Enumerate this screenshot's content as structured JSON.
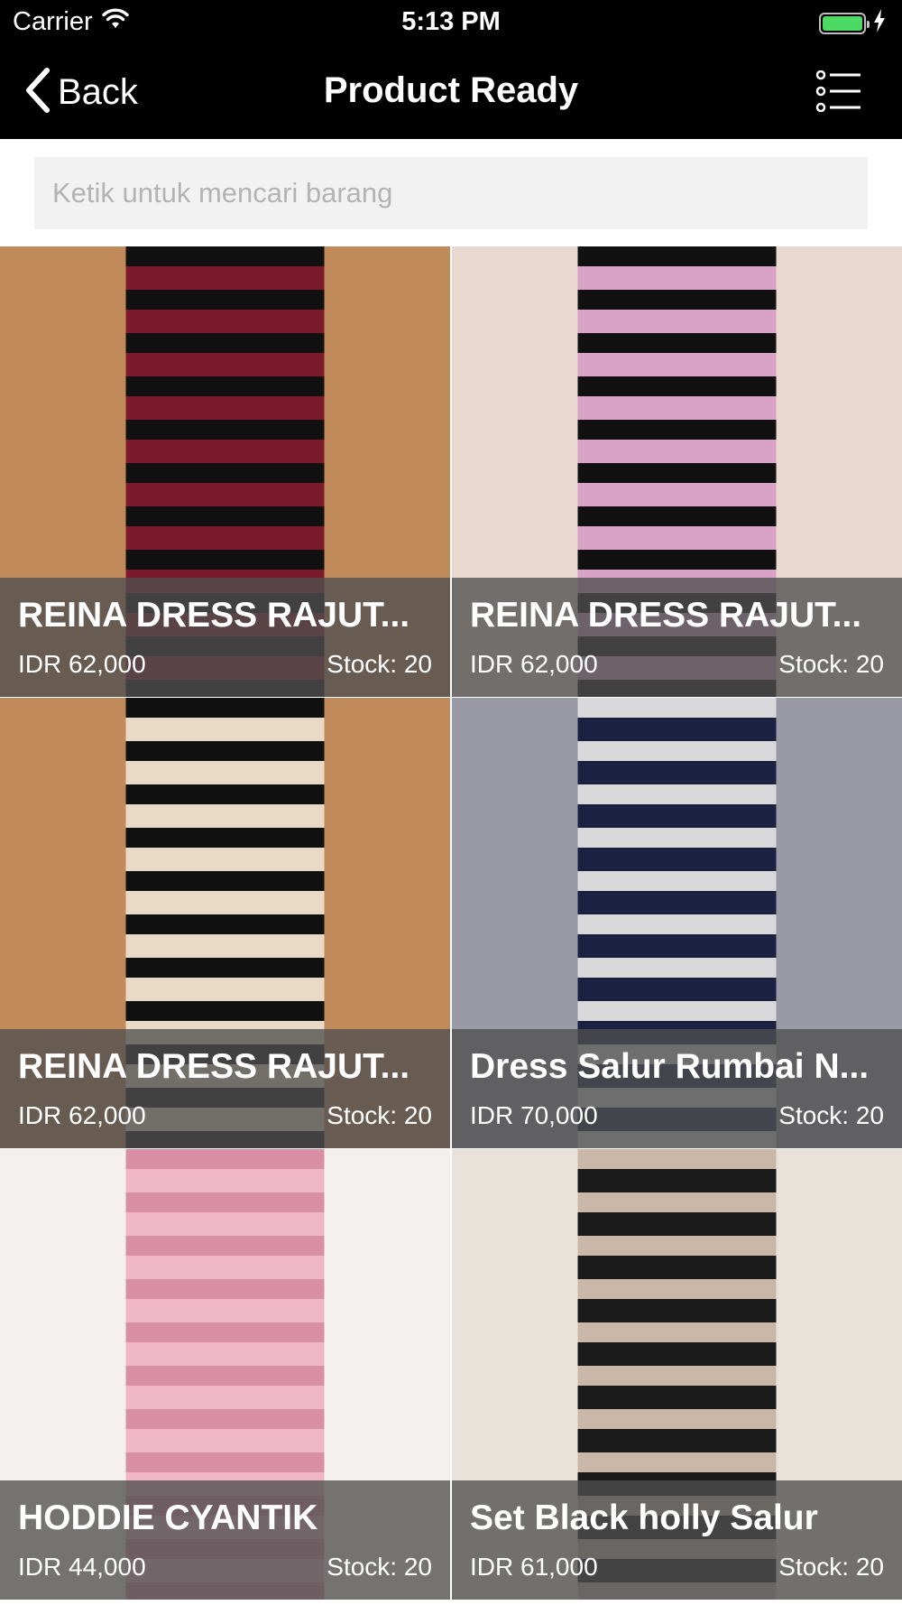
{
  "status_bar": {
    "carrier": "Carrier",
    "time": "5:13 PM",
    "icons": [
      "wifi-icon",
      "battery-icon",
      "charging-bolt-icon"
    ],
    "battery_color": "#4cd964"
  },
  "nav": {
    "back_label": "Back",
    "title": "Product Ready",
    "menu_icon": "list-menu-icon",
    "background": "#000000"
  },
  "search": {
    "placeholder": "Ketik untuk mencari barang",
    "value": ""
  },
  "products": [
    {
      "name": "REINA DRESS RAJUT...",
      "price": "IDR 62,000",
      "stock": "Stock: 20",
      "image": "model in black and maroon striped knit dress",
      "palette": [
        "#c08a5a",
        "#7a1a2a",
        "#111111"
      ]
    },
    {
      "name": "REINA DRESS RAJUT...",
      "price": "IDR 62,000",
      "stock": "Stock: 20",
      "image": "model in black and pink striped knit dress",
      "palette": [
        "#e8d8d0",
        "#d9a3c8",
        "#111111"
      ]
    },
    {
      "name": "REINA DRESS RAJUT...",
      "price": "IDR 62,000",
      "stock": "Stock: 20",
      "image": "model in black and cream striped knit dress",
      "palette": [
        "#c08a5a",
        "#ead9c4",
        "#111111"
      ]
    },
    {
      "name": "Dress Salur Rumbai N...",
      "price": "IDR 70,000",
      "stock": "Stock: 20",
      "image": "woman in navy striped ruffle dress taking selfie",
      "palette": [
        "#9a9aa6",
        "#1b2140",
        "#d9d9dc"
      ]
    },
    {
      "name": "HODDIE CYANTIK",
      "price": "IDR 44,000",
      "stock": "Stock: 20",
      "image": "woman in pink hoodie",
      "palette": [
        "#f4f0ee",
        "#efb7c6",
        "#d88fa6"
      ]
    },
    {
      "name": "Set Black holly Salur",
      "price": "IDR 61,000",
      "stock": "Stock: 20",
      "image": "woman in black top and striped wide pants",
      "palette": [
        "#e9e2da",
        "#1a1a1a",
        "#c9b8a8"
      ]
    }
  ]
}
